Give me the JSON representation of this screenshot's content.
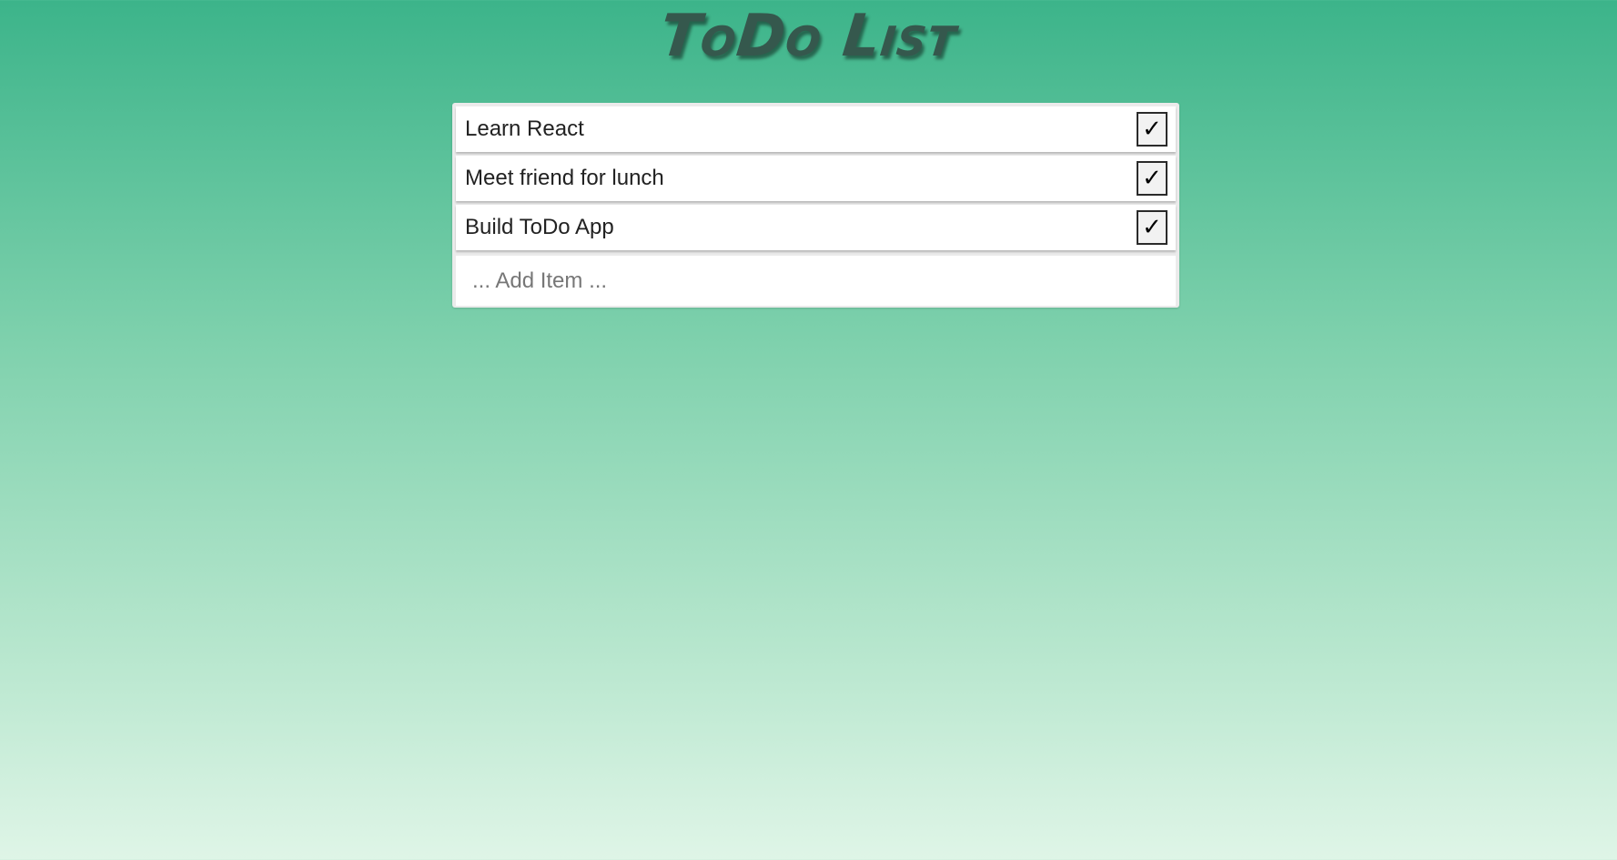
{
  "app": {
    "title": "ToDo List"
  },
  "todos": [
    {
      "text": "Learn React",
      "check_symbol": "✓"
    },
    {
      "text": "Meet friend for lunch",
      "check_symbol": "✓"
    },
    {
      "text": "Build ToDo App",
      "check_symbol": "✓"
    }
  ],
  "add_item": {
    "placeholder": "... Add Item ...",
    "value": ""
  },
  "colors": {
    "background_top": "#3cb48a",
    "background_bottom": "#dff5e7",
    "title": "#35584d",
    "panel": "#ebebeb"
  }
}
